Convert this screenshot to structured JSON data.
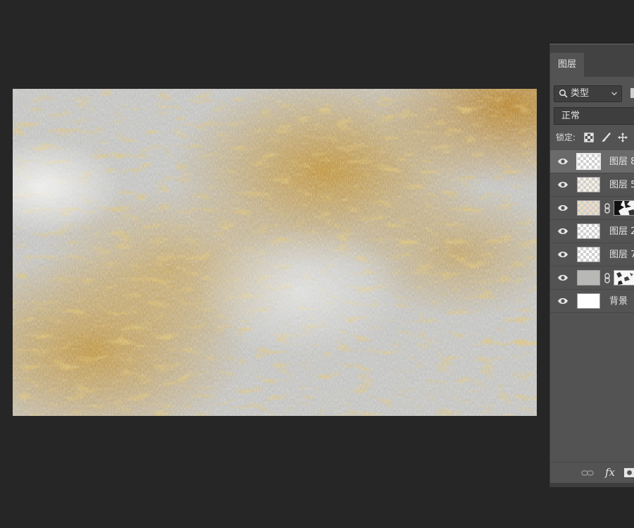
{
  "canvas": {
    "colors": {
      "base": "#c4c4c2",
      "gold": "#c08f2c",
      "white": "#ececea",
      "dark": "#9b9b98"
    }
  },
  "layers_panel": {
    "tab_label": "图层",
    "filter": {
      "label": "类型",
      "icon": "search-icon",
      "dropdown_icon": "chevron-down-icon"
    },
    "blend_mode": "正常",
    "lock_label": "锁定:",
    "lock_icons": [
      "lock-transparent-pixels-icon",
      "lock-image-pixels-icon",
      "lock-position-icon"
    ],
    "layers": [
      {
        "name": "图层 8",
        "visible": true,
        "selected": true,
        "thumbnail": "transparent",
        "mask": false
      },
      {
        "name": "图层 5",
        "visible": true,
        "selected": false,
        "thumbnail": "transparent-warm",
        "mask": false
      },
      {
        "name": "",
        "visible": true,
        "selected": false,
        "thumbnail": "transparent-warm",
        "mask": true,
        "mask_style": "dark"
      },
      {
        "name": "图层 2",
        "visible": true,
        "selected": false,
        "thumbnail": "transparent",
        "mask": false
      },
      {
        "name": "图层 7",
        "visible": true,
        "selected": false,
        "thumbnail": "transparent",
        "mask": false
      },
      {
        "name": "",
        "visible": true,
        "selected": false,
        "thumbnail": "gray",
        "mask": true,
        "mask_style": "light"
      },
      {
        "name": "背景",
        "visible": true,
        "selected": false,
        "thumbnail": "white",
        "mask": false
      }
    ],
    "bottom_icons": [
      "link-layers-icon",
      "fx-icon",
      "add-mask-icon"
    ],
    "fx_label": "fx"
  }
}
